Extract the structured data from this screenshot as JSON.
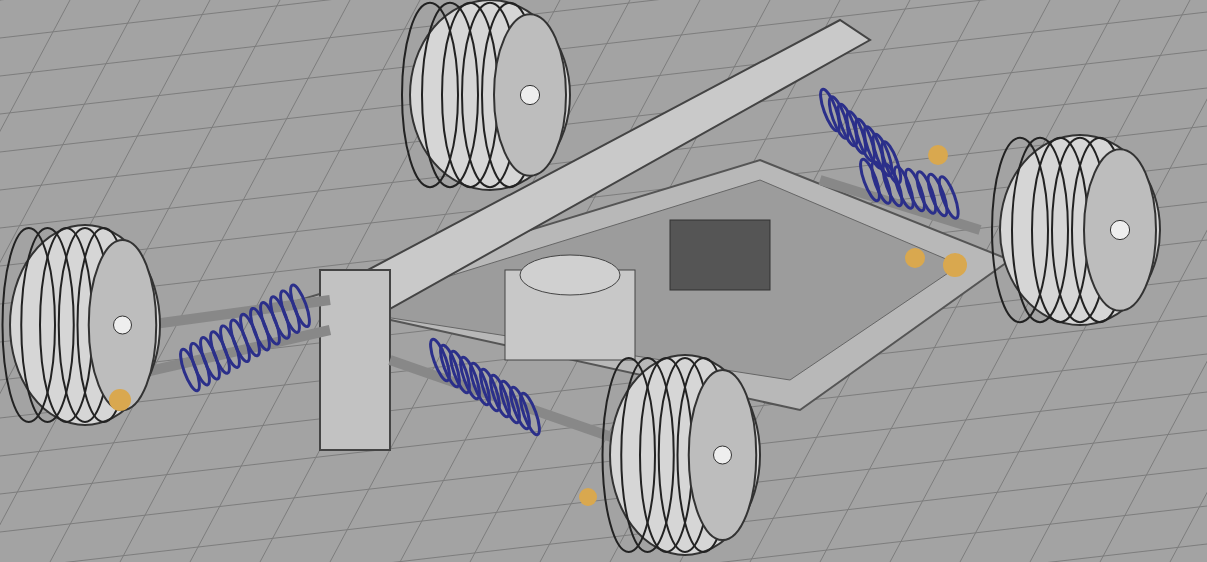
{
  "viewport": {
    "kind": "cad-render",
    "show_grid": true
  }
}
